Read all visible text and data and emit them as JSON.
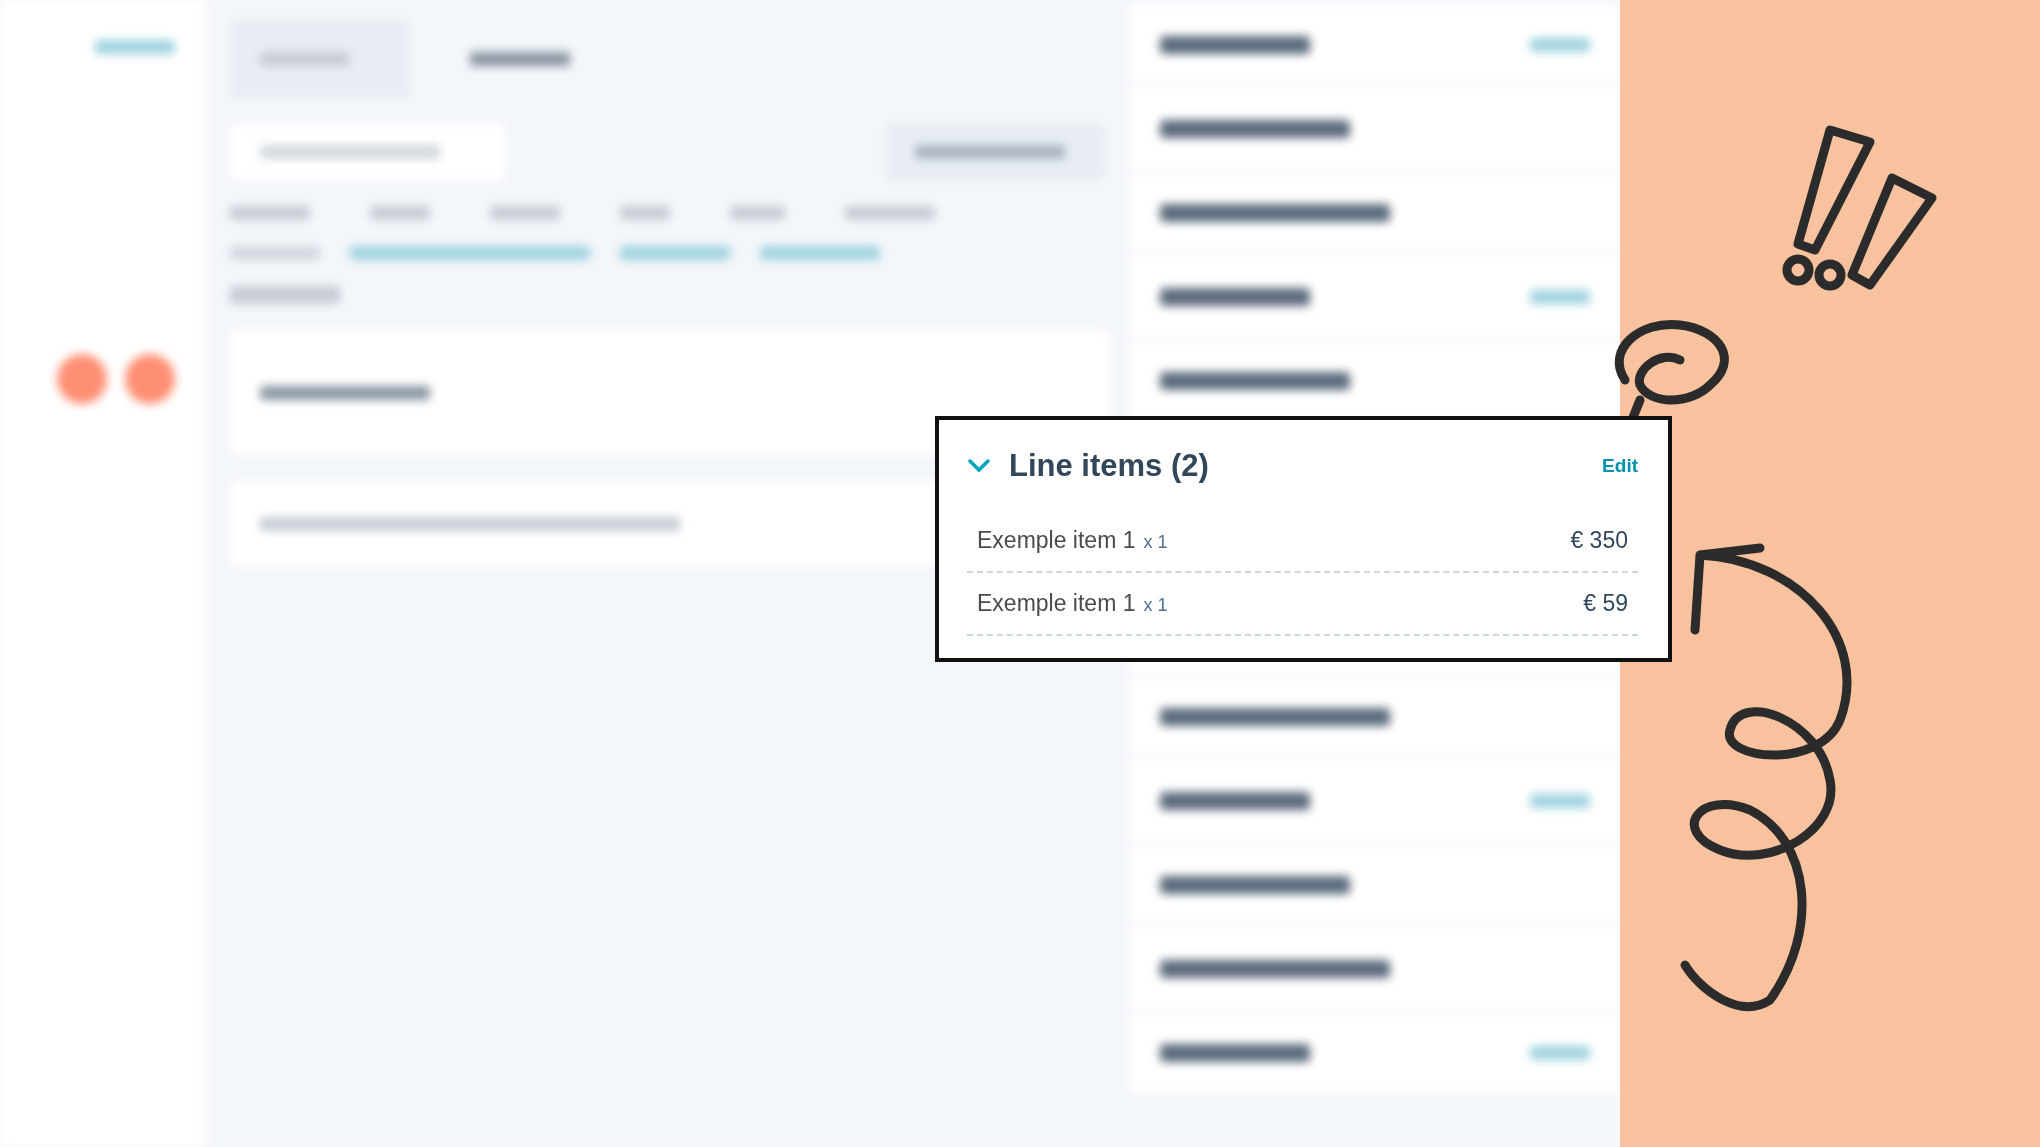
{
  "card": {
    "title": "Line items (2)",
    "expanded": true,
    "action": "Edit",
    "items": [
      {
        "name": "Exemple item 1",
        "quantity": "x 1",
        "price": "€ 350"
      },
      {
        "name": "Exemple item 1",
        "quantity": "x 1",
        "price": "€ 59"
      }
    ]
  }
}
